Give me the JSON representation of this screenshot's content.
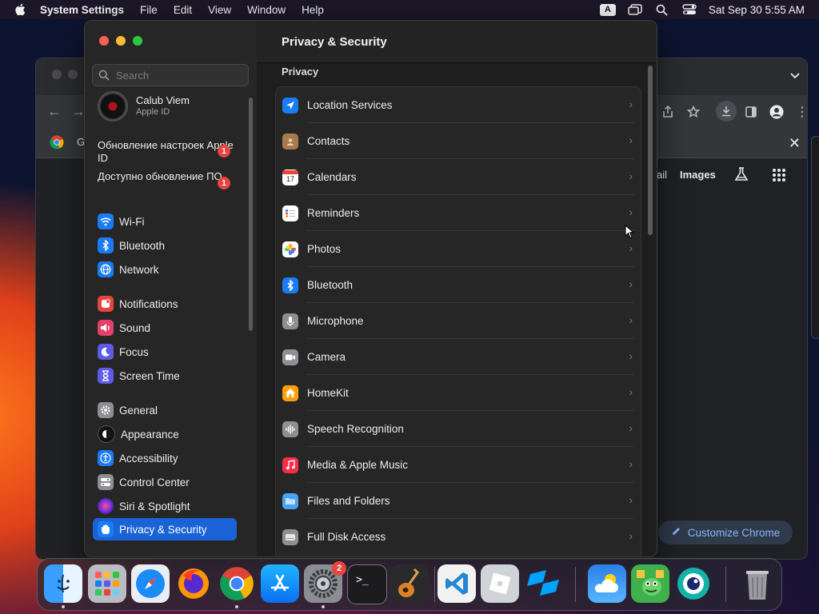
{
  "menubar": {
    "app_name": "System Settings",
    "menus": [
      "File",
      "Edit",
      "View",
      "Window",
      "Help"
    ],
    "input_source": "A",
    "datetime": "Sat Sep 30  5:55 AM"
  },
  "chrome": {
    "partial_tab_text": "G",
    "link_mail_partial": "ail",
    "link_images": "Images",
    "customize_button": "Customize Chrome"
  },
  "settings": {
    "title": "Privacy & Security",
    "search_placeholder": "Search",
    "profile": {
      "name": "Calub Viem",
      "subtitle": "Apple ID"
    },
    "notices": [
      {
        "text": "Обновление настроек Apple ID",
        "badge": "1"
      },
      {
        "text": "Доступно обновление ПО",
        "badge": "1"
      }
    ],
    "sidebar": {
      "groups": [
        [
          {
            "label": "Wi-Fi",
            "icon": "wifi-icon",
            "color": "#1a7cf5"
          },
          {
            "label": "Bluetooth",
            "icon": "bluetooth-icon",
            "color": "#1a7cf5"
          },
          {
            "label": "Network",
            "icon": "globe-icon",
            "color": "#1a7cf5"
          }
        ],
        [
          {
            "label": "Notifications",
            "icon": "bell-icon",
            "color": "#e5453d"
          },
          {
            "label": "Sound",
            "icon": "speaker-icon",
            "color": "#e5406a"
          },
          {
            "label": "Focus",
            "icon": "moon-icon",
            "color": "#5e5ce6"
          },
          {
            "label": "Screen Time",
            "icon": "hourglass-icon",
            "color": "#5e5ce6"
          }
        ],
        [
          {
            "label": "General",
            "icon": "gear-icon",
            "color": "#8e8e93"
          },
          {
            "label": "Appearance",
            "icon": "appearance-icon",
            "color": "#111111"
          },
          {
            "label": "Accessibility",
            "icon": "accessibility-icon",
            "color": "#1a7cf5"
          },
          {
            "label": "Control Center",
            "icon": "toggles-icon",
            "color": "#8e8e93"
          },
          {
            "label": "Siri & Spotlight",
            "icon": "siri-icon",
            "color": "#6b2fd6"
          },
          {
            "label": "Privacy & Security",
            "icon": "hand-icon",
            "color": "#1a7cf5",
            "selected": true
          }
        ]
      ]
    },
    "section_label": "Privacy",
    "privacy_items": [
      {
        "label": "Location Services",
        "icon": "location-arrow-icon",
        "color": "#1a7cf5"
      },
      {
        "label": "Contacts",
        "icon": "contacts-icon",
        "color": "#a77c4c"
      },
      {
        "label": "Calendars",
        "icon": "calendar-icon",
        "color": "#ffffff",
        "calendar_day": "17"
      },
      {
        "label": "Reminders",
        "icon": "reminders-icon",
        "color": "#ffffff"
      },
      {
        "label": "Photos",
        "icon": "photos-icon",
        "color": "#ffffff"
      },
      {
        "label": "Bluetooth",
        "icon": "bluetooth-icon",
        "color": "#1a7cf5"
      },
      {
        "label": "Microphone",
        "icon": "microphone-icon",
        "color": "#8e8e93"
      },
      {
        "label": "Camera",
        "icon": "camera-icon",
        "color": "#8e8e93"
      },
      {
        "label": "HomeKit",
        "icon": "home-icon",
        "color": "#ff9f0a"
      },
      {
        "label": "Speech Recognition",
        "icon": "waveform-icon",
        "color": "#8e8e93"
      },
      {
        "label": "Media & Apple Music",
        "icon": "music-note-icon",
        "color": "#fa2d48"
      },
      {
        "label": "Files and Folders",
        "icon": "folder-icon",
        "color": "#4aa3f0"
      },
      {
        "label": "Full Disk Access",
        "icon": "disk-icon",
        "color": "#8e8e93"
      }
    ]
  },
  "dock": {
    "apps": [
      {
        "name": "finder-icon",
        "running": true
      },
      {
        "name": "launchpad-icon",
        "running": false
      },
      {
        "name": "safari-icon",
        "running": false
      },
      {
        "name": "firefox-icon",
        "running": false
      },
      {
        "name": "chrome-icon",
        "running": true
      },
      {
        "name": "app-store-icon",
        "running": false
      },
      {
        "name": "system-settings-icon",
        "running": true,
        "badge": "2"
      },
      {
        "name": "terminal-icon",
        "running": false
      },
      {
        "name": "garageband-icon",
        "running": false
      },
      {
        "name": "vscode-icon",
        "running": false
      },
      {
        "name": "roblox-icon",
        "running": false
      },
      {
        "name": "roblox-studio-icon",
        "running": false
      },
      {
        "name": "weather-icon",
        "running": false
      },
      {
        "name": "game-icon",
        "running": false
      },
      {
        "name": "camo-icon",
        "running": false
      },
      {
        "name": "trash-icon",
        "running": false
      }
    ]
  }
}
